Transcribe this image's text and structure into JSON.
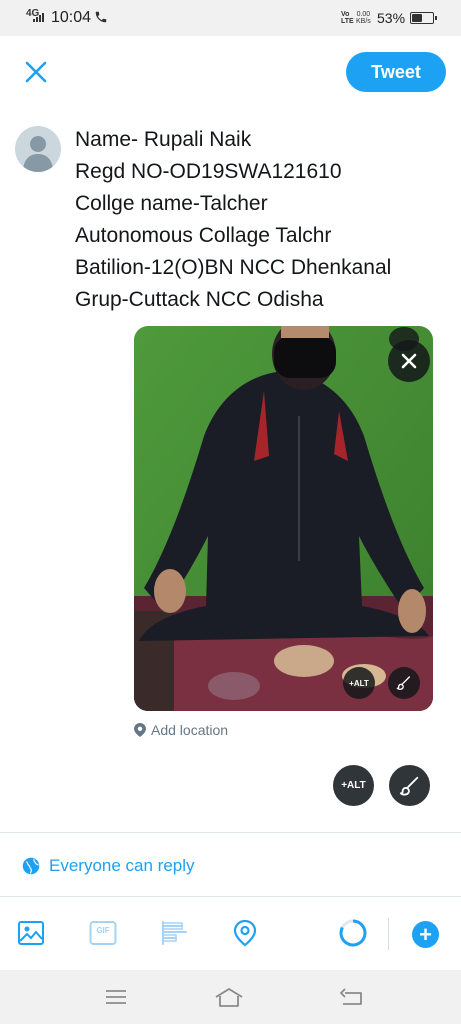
{
  "status_bar": {
    "network": "4G",
    "time": "10:04",
    "volte": "Vo LTE",
    "speed_value": "0.00",
    "speed_unit": "KB/s",
    "battery": "53%",
    "battery_level": 0.53
  },
  "header": {
    "tweet_label": "Tweet"
  },
  "compose": {
    "lines": [
      "Name- Rupali Naik",
      "Regd NO-OD19SWA121610",
      "Collge name-Talcher",
      "Autonomous Collage Talchr",
      "Batilion-12(O)BN NCC Dhenkanal",
      "Grup-Cuttack NCC Odisha"
    ]
  },
  "media": {
    "alt_label": "+ALT",
    "add_location": "Add location"
  },
  "reply_setting": {
    "label": "Everyone can reply"
  },
  "toolbar": {
    "gif_label": "GIF",
    "plus": "+"
  },
  "colors": {
    "accent": "#1da1f2",
    "text": "#14171a",
    "muted": "#657786"
  }
}
